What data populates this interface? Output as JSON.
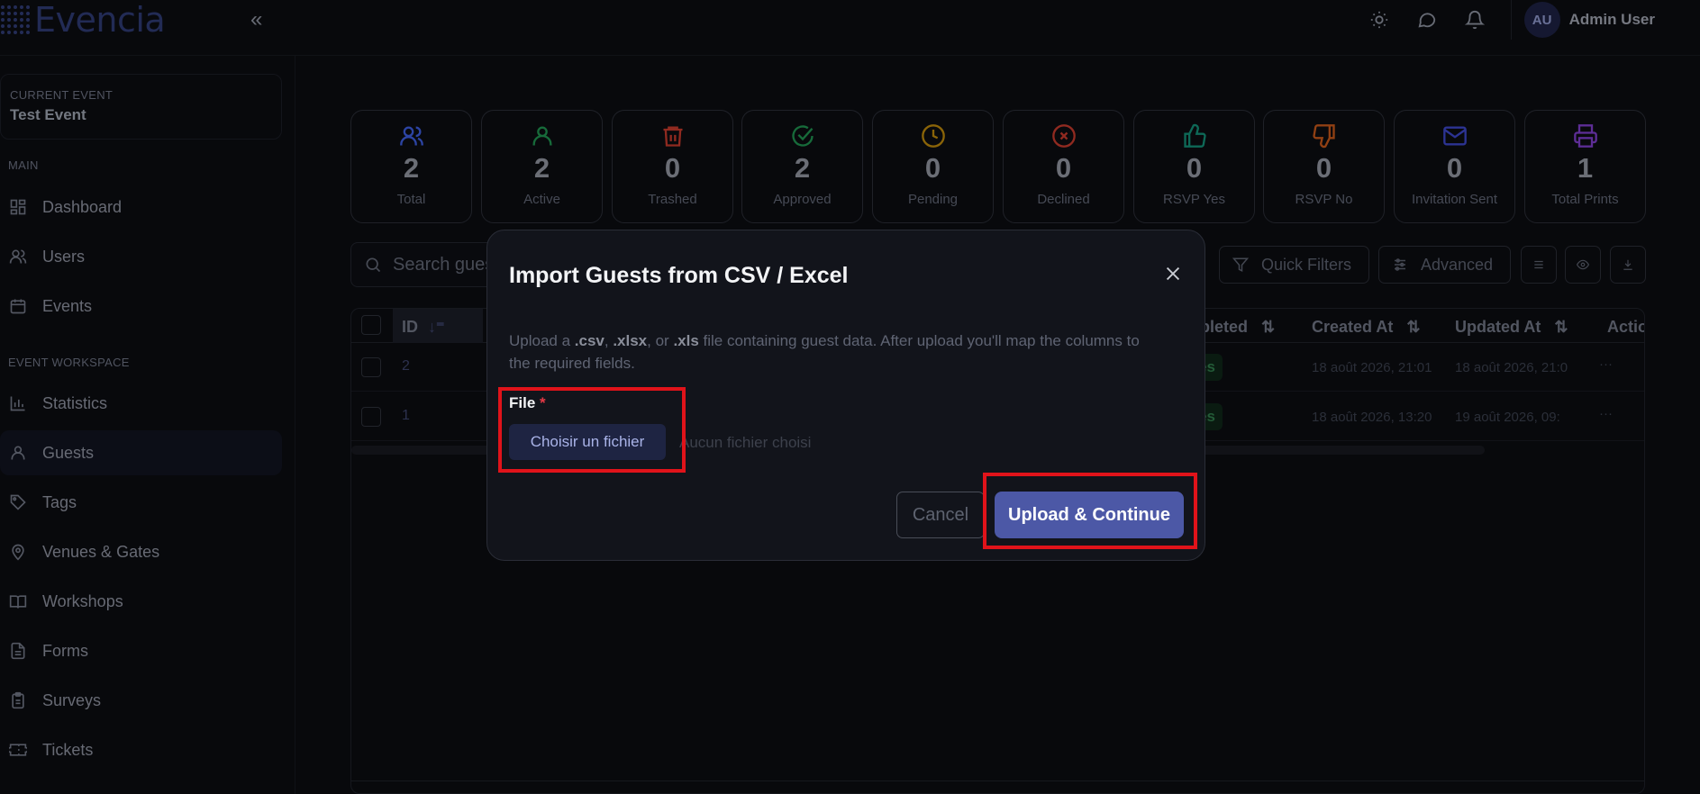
{
  "app": {
    "logo_text": "Evencia",
    "accent": "#4c58a6"
  },
  "topbar": {
    "icons": [
      "sun-icon",
      "chat-icon",
      "bell-icon"
    ],
    "user_initials": "AU",
    "user_name": "Admin User"
  },
  "sidebar": {
    "current_event_label": "CURRENT EVENT",
    "current_event_name": "Test Event",
    "main_label": "MAIN",
    "workspace_label": "EVENT WORKSPACE",
    "main_items": [
      {
        "label": "Dashboard",
        "icon": "dashboard-icon"
      },
      {
        "label": "Users",
        "icon": "users-icon"
      },
      {
        "label": "Events",
        "icon": "calendar-icon"
      }
    ],
    "workspace_items": [
      {
        "label": "Statistics",
        "icon": "bar-chart-icon"
      },
      {
        "label": "Guests",
        "icon": "user-icon",
        "active": true
      },
      {
        "label": "Tags",
        "icon": "tag-icon"
      },
      {
        "label": "Venues & Gates",
        "icon": "map-pin-icon"
      },
      {
        "label": "Workshops",
        "icon": "book-icon"
      },
      {
        "label": "Forms",
        "icon": "file-icon"
      },
      {
        "label": "Surveys",
        "icon": "clipboard-icon"
      },
      {
        "label": "Tickets",
        "icon": "ticket-icon"
      }
    ]
  },
  "stats": [
    {
      "value": "2",
      "label": "Total",
      "color": "#3b5bdb"
    },
    {
      "value": "2",
      "label": "Active",
      "color": "#1f8f4e"
    },
    {
      "value": "0",
      "label": "Trashed",
      "color": "#c0392b"
    },
    {
      "value": "2",
      "label": "Approved",
      "color": "#1f8f4e"
    },
    {
      "value": "0",
      "label": "Pending",
      "color": "#b8860b"
    },
    {
      "value": "0",
      "label": "Declined",
      "color": "#c0392b"
    },
    {
      "value": "0",
      "label": "RSVP Yes",
      "color": "#138d75"
    },
    {
      "value": "0",
      "label": "RSVP No",
      "color": "#c2561a"
    },
    {
      "value": "0",
      "label": "Invitation Sent",
      "color": "#3b45c4"
    },
    {
      "value": "1",
      "label": "Total Prints",
      "color": "#7d3cc8"
    }
  ],
  "toolbar": {
    "search_placeholder": "Search guests...",
    "quick_filters": "Quick Filters",
    "advanced": "Advanced"
  },
  "table": {
    "columns": {
      "id": "ID",
      "completed": "mpleted",
      "created": "Created At",
      "updated": "Updated At",
      "actions": "Actions"
    },
    "rows": [
      {
        "id": "2",
        "badge": "es",
        "created": "18 août 2026, 21:01",
        "updated": "18 août 2026, 21:0"
      },
      {
        "id": "1",
        "badge": "es",
        "created": "18 août 2026, 13:20",
        "updated": "19 août 2026, 09:"
      }
    ],
    "row_actions": "···"
  },
  "modal": {
    "title": "Import Guests from CSV / Excel",
    "desc_1": "Upload a ",
    "ext_csv": ".csv",
    "sep_1": ", ",
    "ext_xlsx": ".xlsx",
    "sep_2": ", or ",
    "ext_xls": ".xls",
    "desc_2": " file containing guest data. After upload you'll map the columns to the required fields.",
    "file_label": "File",
    "required_mark": "*",
    "choose_button": "Choisir un fichier",
    "no_file": "Aucun fichier choisi",
    "cancel": "Cancel",
    "upload": "Upload & Continue"
  }
}
